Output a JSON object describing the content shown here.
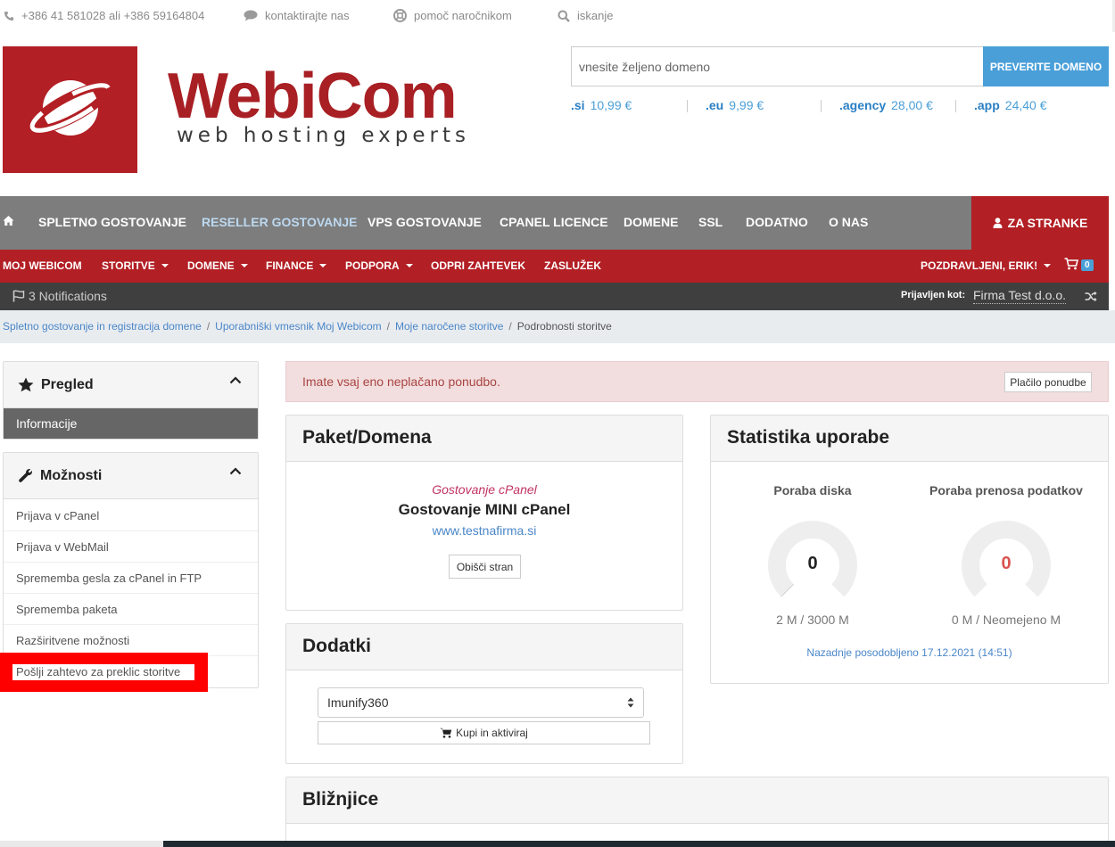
{
  "topbar": {
    "phone": "+386 41 581028 ali +386 59164804",
    "contact": "kontaktirajte nas",
    "support": "pomoč naročnikom",
    "search": "iskanje"
  },
  "logo": {
    "title": "WebiCom",
    "subtitle": "web hosting experts"
  },
  "domain_search": {
    "placeholder": "vnesite željeno domeno",
    "button": "PREVERITE DOMENO",
    "tlds": [
      {
        "name": ".si",
        "price": "10,99 €"
      },
      {
        "name": ".eu",
        "price": "9,99 €"
      },
      {
        "name": ".agency",
        "price": "28,00 €"
      },
      {
        "name": ".app",
        "price": "24,40 €"
      }
    ]
  },
  "main_nav": {
    "items": [
      "SPLETNO GOSTOVANJE",
      "RESELLER GOSTOVANJE",
      "VPS GOSTOVANJE",
      "CPANEL LICENCE",
      "DOMENE",
      "SSL",
      "DODATNO",
      "O NAS"
    ],
    "client_button": "ZA STRANKE"
  },
  "client_nav": {
    "items": [
      "MOJ WEBICOM",
      "STORITVE",
      "DOMENE",
      "FINANCE",
      "PODPORA",
      "ODPRI ZAHTEVEK",
      "ZASLUŽEK"
    ],
    "greeting": "POZDRAVLJENI, ERIK!",
    "cart_count": "0"
  },
  "notifications": {
    "label": "3 Notifications",
    "logged_in_label": "Prijavljen kot:",
    "company": "Firma Test d.o.o."
  },
  "breadcrumb": [
    "Spletno gostovanje in registracija domene",
    "Uporabniški vmesnik Moj Webicom",
    "Moje naročene storitve",
    "Podrobnosti storitve"
  ],
  "sidebar": {
    "overview_title": "Pregled",
    "overview_active": "Informacije",
    "options_title": "Možnosti",
    "options": [
      "Prijava v cPanel",
      "Prijava v WebMail",
      "Sprememba gesla za cPanel in FTP",
      "Sprememba paketa",
      "Razširitvene možnosti",
      "Pošlji zahtevo za preklic storitve"
    ]
  },
  "alert": {
    "text": "Imate vsaj eno neplačano ponudbo.",
    "button": "Plačilo ponudbe"
  },
  "package": {
    "title": "Paket/Domena",
    "category": "Gostovanje cPanel",
    "name": "Gostovanje MINI cPanel",
    "domain": "www.testnafirma.si",
    "visit_button": "Obišči stran"
  },
  "addons": {
    "title": "Dodatki",
    "selected": "Imunify360",
    "buy_button": "Kupi in aktiviraj"
  },
  "shortcuts": {
    "title": "Bližnjice"
  },
  "stats": {
    "title": "Statistika uporabe",
    "disk": {
      "label": "Poraba diska",
      "value": "0",
      "usage": "2 M / 3000 M",
      "fraction": 0.0007
    },
    "bandwidth": {
      "label": "Poraba prenosa podatkov",
      "value": "0",
      "usage": "0 M / Neomejeno M",
      "fraction": 0
    },
    "updated": "Nazadnje posodobljeno 17.12.2021 (14:51)"
  },
  "colors": {
    "brand_red": "#b21f24",
    "accent_blue": "#4a9fd8",
    "nav_gray": "#7d7d7d"
  }
}
